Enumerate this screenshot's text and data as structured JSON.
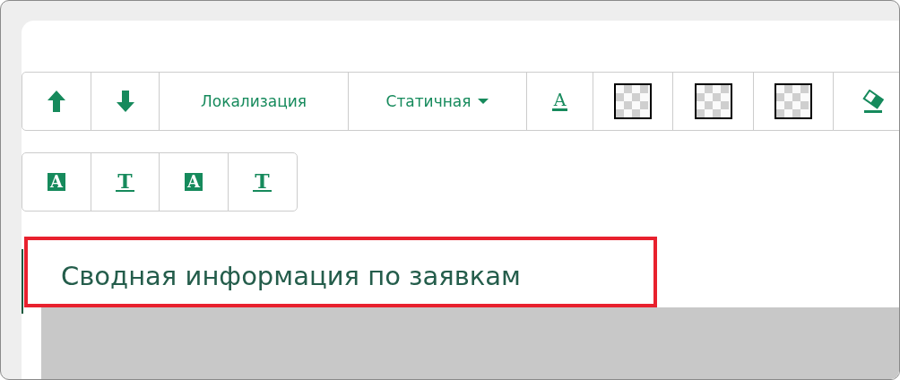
{
  "toolbar_rows": [
    {
      "items": [
        {
          "kind": "up"
        },
        {
          "kind": "down"
        },
        {
          "kind": "text",
          "label": "Локализация"
        },
        {
          "kind": "dropdown",
          "label": "Статичная"
        },
        {
          "kind": "font-color",
          "glyph": "A"
        },
        {
          "kind": "swatch"
        },
        {
          "kind": "swatch"
        },
        {
          "kind": "swatch"
        },
        {
          "kind": "eraser"
        }
      ]
    },
    {
      "items": [
        {
          "kind": "filled-letter",
          "glyph": "A"
        },
        {
          "kind": "underlined-letter",
          "glyph": "T"
        },
        {
          "kind": "filled-letter",
          "glyph": "A"
        },
        {
          "kind": "underlined-letter",
          "glyph": "T"
        }
      ]
    }
  ],
  "heading": {
    "text": "Сводная информация по заявкам",
    "highlighted": true
  }
}
